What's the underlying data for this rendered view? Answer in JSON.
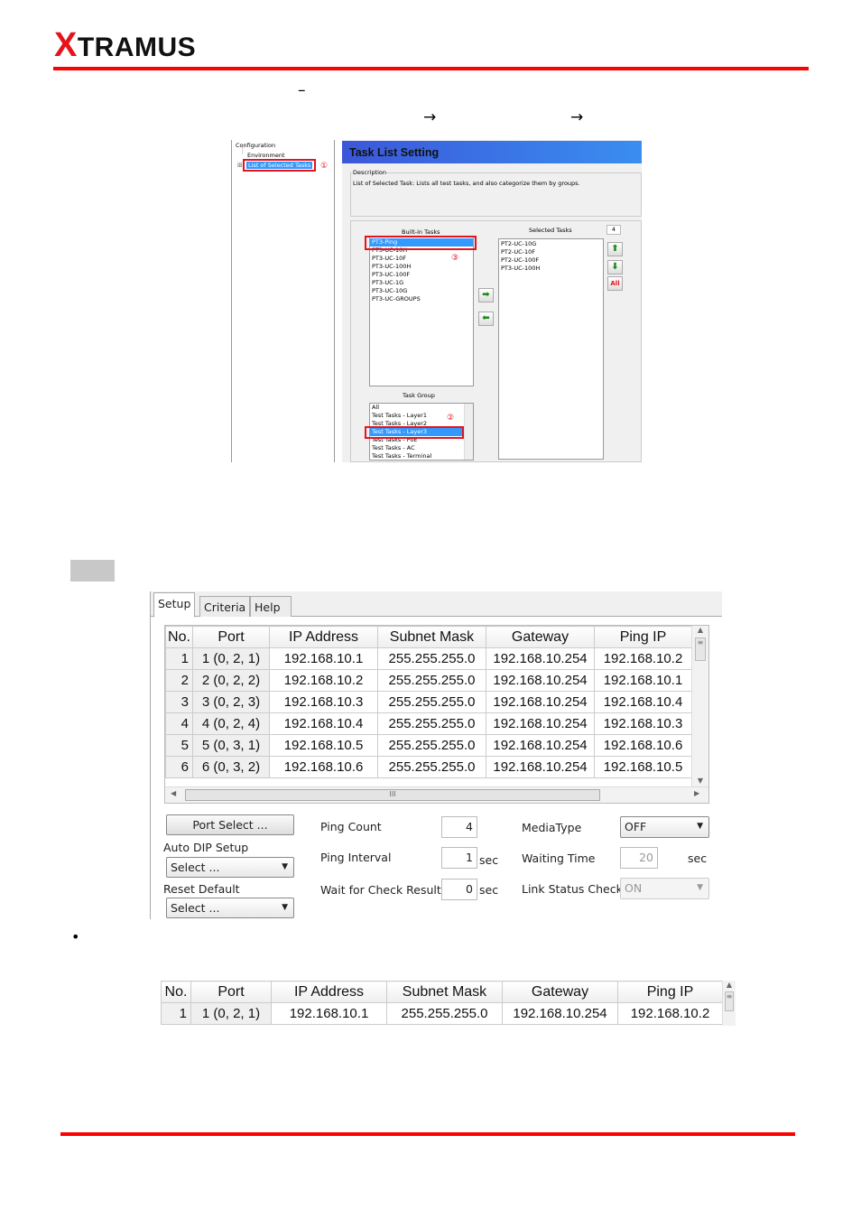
{
  "header": {
    "logo_x": "X",
    "logo_rest": "TRAMUS",
    "brand_red": "#e3141c"
  },
  "page_text": {
    "dash": "–",
    "arrow1": "→",
    "arrow2": "→",
    "bullet": "•"
  },
  "task_window": {
    "tree": {
      "root": "Configuration",
      "items": [
        "Environment",
        "List of Selected Tasks"
      ],
      "expand_icon": "plus-box-icon"
    },
    "title": "Task List Setting",
    "description_label": "Description",
    "description_text": "List of Selected Task: Lists all test tasks, and also categorize them by groups.",
    "builtin_label": "Built-in Tasks",
    "builtin_items": [
      "PT3-Ping",
      "PT3-UC-10H",
      "PT3-UC-10F",
      "PT3-UC-100H",
      "PT3-UC-100F",
      "PT3-UC-1G",
      "PT3-UC-10G",
      "PT3-UC-GROUPS"
    ],
    "selected_label": "Selected Tasks",
    "selected_count": "4",
    "selected_items": [
      "PT2-UC-10G",
      "PT2-UC-10F",
      "PT2-UC-100F",
      "PT3-UC-100H"
    ],
    "group_label": "Task Group",
    "group_items": [
      "All",
      "Test Tasks - Layer1",
      "Test Tasks - Layer2",
      "Test Tasks - Layer3",
      "Test Tasks - PoE",
      "Test Tasks - AC",
      "Test Tasks - Terminal"
    ],
    "callouts": [
      "①",
      "②",
      "③"
    ],
    "clear_all_label": "All",
    "highlight_color": "#3399ff"
  },
  "setup_panel": {
    "tabs": [
      "Setup",
      "Criteria",
      "Help"
    ],
    "active_tab": "Setup",
    "columns": [
      "No.",
      "Port",
      "IP Address",
      "Subnet Mask",
      "Gateway",
      "Ping IP"
    ],
    "rows": [
      [
        "1",
        "1 (0, 2, 1)",
        "192.168.10.1",
        "255.255.255.0",
        "192.168.10.254",
        "192.168.10.2"
      ],
      [
        "2",
        "2 (0, 2, 2)",
        "192.168.10.2",
        "255.255.255.0",
        "192.168.10.254",
        "192.168.10.1"
      ],
      [
        "3",
        "3 (0, 2, 3)",
        "192.168.10.3",
        "255.255.255.0",
        "192.168.10.254",
        "192.168.10.4"
      ],
      [
        "4",
        "4 (0, 2, 4)",
        "192.168.10.4",
        "255.255.255.0",
        "192.168.10.254",
        "192.168.10.3"
      ],
      [
        "5",
        "5 (0, 3, 1)",
        "192.168.10.5",
        "255.255.255.0",
        "192.168.10.254",
        "192.168.10.6"
      ],
      [
        "6",
        "6 (0, 3, 2)",
        "192.168.10.6",
        "255.255.255.0",
        "192.168.10.254",
        "192.168.10.5"
      ]
    ],
    "port_select": "Port Select ...",
    "auto_dip_label": "Auto DIP Setup",
    "auto_dip_value": "Select ...",
    "reset_label": "Reset Default",
    "reset_value": "Select ...",
    "ping_count_label": "Ping Count",
    "ping_count": "4",
    "ping_interval_label": "Ping Interval",
    "ping_interval": "1",
    "wait_label": "Wait for Check Result",
    "wait": "0",
    "sec": "sec",
    "media_label": "MediaType",
    "media_value": "OFF",
    "waiting_label": "Waiting Time",
    "waiting_value": "20",
    "link_label": "Link Status Check",
    "link_value": "ON"
  },
  "single_row_table": {
    "columns": [
      "No.",
      "Port",
      "IP Address",
      "Subnet Mask",
      "Gateway",
      "Ping IP"
    ],
    "rows": [
      [
        "1",
        "1 (0, 2, 1)",
        "192.168.10.1",
        "255.255.255.0",
        "192.168.10.254",
        "192.168.10.2"
      ]
    ]
  }
}
